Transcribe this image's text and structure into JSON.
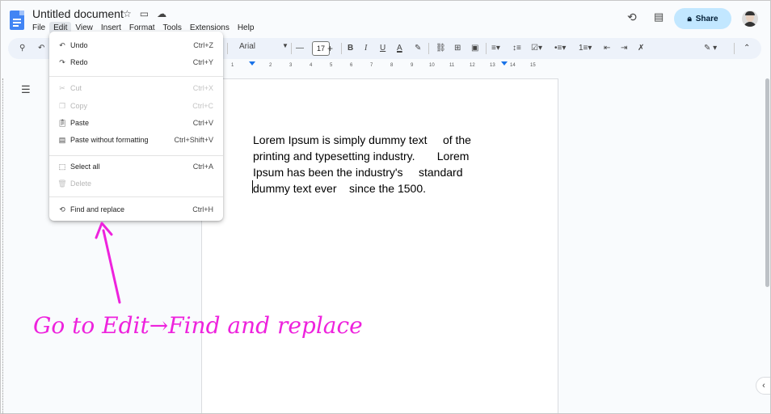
{
  "document": {
    "title": "Untitled document",
    "lines": [
      "Lorem Ipsum is simply dummy text     of the",
      "printing and typesetting industry.       Lorem",
      "Ipsum has been the industry's     standard",
      "dummy text ever    since the 1500."
    ]
  },
  "menubar": [
    "File",
    "Edit",
    "View",
    "Insert",
    "Format",
    "Tools",
    "Extensions",
    "Help"
  ],
  "header": {
    "share_label": "Share"
  },
  "toolbar": {
    "font": "Arial",
    "font_size": "17"
  },
  "ruler": {
    "ticks": [
      "1",
      "2",
      "3",
      "4",
      "5",
      "6",
      "7",
      "8",
      "9",
      "10",
      "11",
      "12",
      "13",
      "14",
      "15"
    ]
  },
  "edit_menu": {
    "items": [
      {
        "label": "Undo",
        "shortcut": "Ctrl+Z",
        "icon": "undo-icon",
        "enabled": true
      },
      {
        "label": "Redo",
        "shortcut": "Ctrl+Y",
        "icon": "redo-icon",
        "enabled": true
      },
      {
        "label": "Cut",
        "shortcut": "Ctrl+X",
        "icon": "scissors-icon",
        "enabled": false
      },
      {
        "label": "Copy",
        "shortcut": "Ctrl+C",
        "icon": "copy-icon",
        "enabled": false
      },
      {
        "label": "Paste",
        "shortcut": "Ctrl+V",
        "icon": "clipboard-icon",
        "enabled": true
      },
      {
        "label": "Paste without formatting",
        "shortcut": "Ctrl+Shift+V",
        "icon": "clipboard-plain-icon",
        "enabled": true
      },
      {
        "label": "Select all",
        "shortcut": "Ctrl+A",
        "icon": "select-all-icon",
        "enabled": true
      },
      {
        "label": "Delete",
        "shortcut": "",
        "icon": "trash-icon",
        "enabled": false
      },
      {
        "label": "Find and replace",
        "shortcut": "Ctrl+H",
        "icon": "find-replace-icon",
        "enabled": true
      }
    ]
  },
  "annotation": {
    "text": "Go to Edit→Find and replace",
    "color": "#ee22dd"
  },
  "colors": {
    "share_bg": "#c2e7ff",
    "toolbar_bg": "#edf2fa",
    "accent": "#1a73e8"
  }
}
